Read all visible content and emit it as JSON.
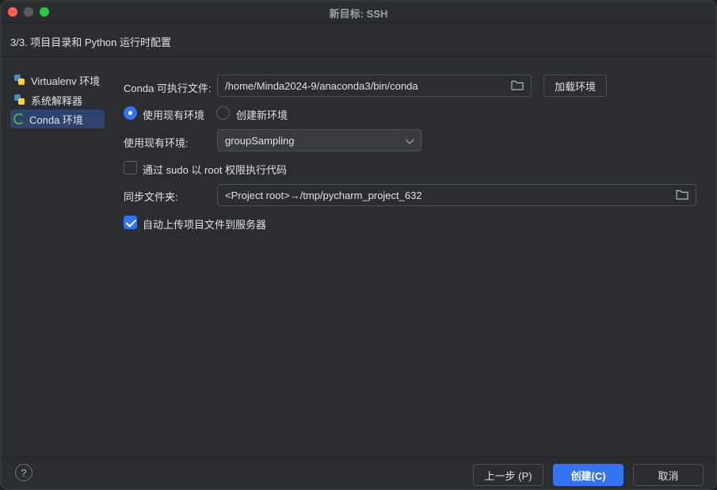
{
  "window": {
    "title": "新目标: SSH"
  },
  "step": {
    "title": "3/3. 项目目录和 Python 运行时配置"
  },
  "sidebar": {
    "items": [
      {
        "label": "Virtualenv 环境",
        "icon": "python-icon",
        "selected": false
      },
      {
        "label": "系统解释器",
        "icon": "python-icon",
        "selected": false
      },
      {
        "label": "Conda 环境",
        "icon": "conda-icon",
        "selected": true
      }
    ]
  },
  "form": {
    "conda_exec_label": "Conda 可执行文件:",
    "conda_exec_value": "/home/Minda2024-9/anaconda3/bin/conda",
    "load_env_button": "加载环境",
    "use_existing_radio": "使用现有环境",
    "create_new_radio": "创建新环境",
    "existing_env_label": "使用现有环境:",
    "existing_env_value": "groupSampling",
    "sudo_checkbox": "通过 sudo 以 root 权限执行代码",
    "sync_folder_label": "同步文件夹:",
    "sync_folder_value": "<Project root>→/tmp/pycharm_project_632",
    "auto_upload_checkbox": "自动上传项目文件到服务器"
  },
  "footer": {
    "help": "?",
    "prev_button": "上一步 (P)",
    "create_button": "创建(C)",
    "cancel_button": "取消"
  },
  "colors": {
    "accent": "#3574f0",
    "background": "#2b2d30",
    "selection": "#2e436e"
  }
}
